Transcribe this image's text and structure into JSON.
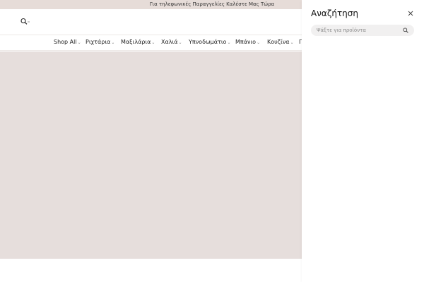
{
  "announcement": {
    "text": "Για τηλεφωνικές Παραγγελίες Καλέστε Μας Τώρα"
  },
  "header": {
    "logo_icon": "logo-magnifier-icon"
  },
  "nav": {
    "items": [
      {
        "label": "Shop All",
        "icon": "chevron-down-icon"
      },
      {
        "label": "Ριχτάρια",
        "icon": "chevron-down-icon"
      },
      {
        "label": "Μαξιλάρια",
        "icon": "chevron-down-icon"
      },
      {
        "label": "Χαλιά",
        "icon": "chevron-down-icon"
      },
      {
        "label": "Υπνοδωμάτιο",
        "icon": "chevron-down-icon"
      },
      {
        "label": "Μπάνιο",
        "icon": "chevron-down-icon"
      },
      {
        "label": "Κουζίνα",
        "icon": "chevron-down-icon"
      },
      {
        "label": "Γ"
      }
    ]
  },
  "hero": {
    "background_color": "#e6dedc"
  },
  "search_drawer": {
    "title": "Αναζήτηση",
    "placeholder": "Ψάξτε για προϊόντα",
    "close_icon": "close-icon",
    "search_icon": "search-icon"
  },
  "colors": {
    "announcement_bg": "#e6dcd8",
    "hero_bg": "#e6dedc",
    "search_field_bg": "#f1f0f0"
  }
}
